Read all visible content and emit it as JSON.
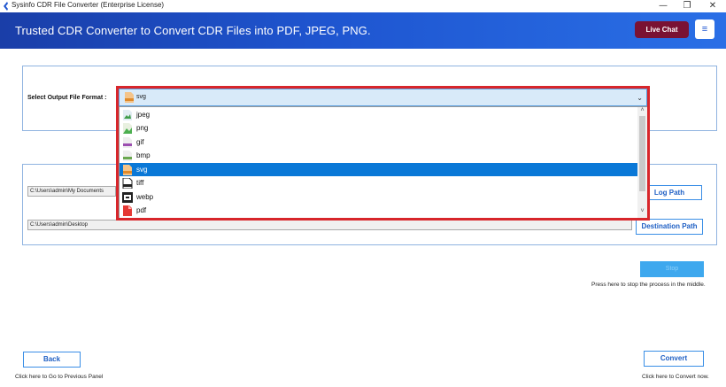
{
  "window": {
    "title": "Sysinfo CDR File Converter (Enterprise License)",
    "minimize": "—",
    "restore": "❐",
    "close": "✕"
  },
  "banner": {
    "headline": "Trusted CDR Converter to Convert CDR Files into PDF, JPEG, PNG.",
    "live_chat": "Live Chat",
    "menu": "≡"
  },
  "format": {
    "label": "Select Output File Format :",
    "selected": "svg",
    "chevron": "⌄",
    "options": [
      {
        "label": "jpeg",
        "icon": "jpeg-file-icon"
      },
      {
        "label": "png",
        "icon": "png-file-icon"
      },
      {
        "label": "gif",
        "icon": "gif-file-icon"
      },
      {
        "label": "bmp",
        "icon": "bmp-file-icon"
      },
      {
        "label": "svg",
        "icon": "svg-file-icon"
      },
      {
        "label": "tiff",
        "icon": "tiff-file-icon"
      },
      {
        "label": "webp",
        "icon": "webp-file-icon"
      },
      {
        "label": "pdf",
        "icon": "pdf-file-icon"
      }
    ],
    "selected_index": 4,
    "scroll_up": "˄",
    "scroll_down": "˅"
  },
  "paths": {
    "log_path_value": "C:\\Users\\admin\\My Documents",
    "log_path_button": "Log Path",
    "destination_value": "C:\\Users\\admin\\Desktop",
    "destination_button": "Destination Path"
  },
  "actions": {
    "stop_button": "Stop",
    "stop_hint": "Press here to stop the process in the middle.",
    "back_button": "Back",
    "back_hint": "Click here to Go to Previous Panel",
    "convert_button": "Convert",
    "convert_hint": "Click here to Convert now."
  },
  "colors": {
    "accent": "#1e55d0",
    "live_chat": "#7a1233",
    "highlight": "#d8262b",
    "selection": "#0a78d7"
  }
}
